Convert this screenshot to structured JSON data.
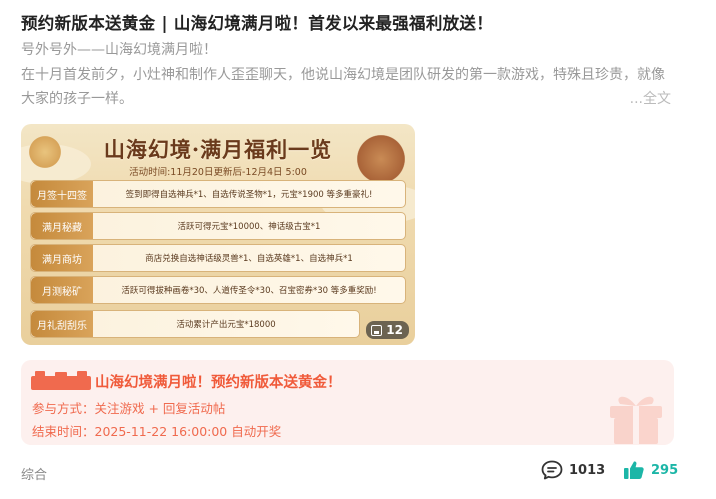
{
  "post": {
    "title": "预约新版本送黄金 | 山海幻境满月啦！首发以来最强福利放送！",
    "subtitle": "号外号外——山海幻境满月啦！",
    "excerpt": "在十月首发前夕，小灶神和制作人歪歪聊天，他说山海幻境是团队研发的第一款游戏，特殊且珍贵，就像大家的孩子一样。",
    "full_text_link": "...全文",
    "category": "综合",
    "comment_count": "1013",
    "like_count": "295"
  },
  "banner": {
    "title": "山海幻境·满月福利一览",
    "time": "活动时间:11月20日更新后-12月4日 5:00",
    "image_count": "12",
    "rows": [
      {
        "tag": "月签十四签",
        "text": "签到即得自选神兵*1、自选传说圣物*1，元宝*1900 等多重豪礼!"
      },
      {
        "tag": "满月秘藏",
        "text": "活跃可得元宝*10000、神话级古宝*1"
      },
      {
        "tag": "满月商坊",
        "text": "商店兑换自选神话级灵兽*1、自选英雄*1、自选神兵*1"
      },
      {
        "tag": "月测秘矿",
        "text": "活跃可得拔种画卷*30、人道传圣令*30、召宝密券*30 等多重奖励!"
      },
      {
        "tag": "月礼刮刮乐",
        "text": "活动累计产出元宝*18000"
      }
    ]
  },
  "event_card": {
    "title": "山海幻境满月啦！预约新版本送黄金！",
    "participation": "参与方式：关注游戏 + 回复活动帖",
    "end_time": "结束时间：2025-11-22 16:00:00 自动开奖"
  },
  "colors": {
    "accent_orange": "#f05a3a",
    "like_teal": "#1cb6a7",
    "card_bg": "#fdf0ee"
  },
  "icons": {
    "comment": "comment-icon",
    "like": "thumbs-up-icon",
    "images": "image-gallery-icon",
    "gift": "gift-icon"
  }
}
